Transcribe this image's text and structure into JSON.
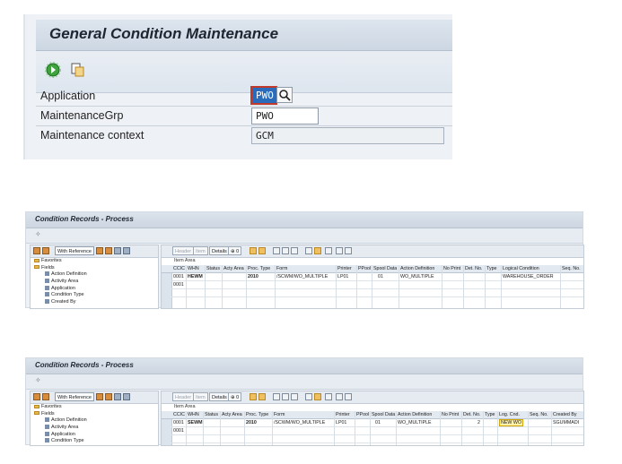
{
  "gcm": {
    "title": "General Condition Maintenance",
    "toolbar": {
      "execute_icon": "execute-icon",
      "copy_icon": "copy-icon"
    },
    "fields": [
      {
        "label": "Application",
        "value": "PWO"
      },
      {
        "label": "MaintenanceGrp",
        "value": "PWO"
      },
      {
        "label": "Maintenance context",
        "value": "GCM"
      }
    ]
  },
  "panels": [
    {
      "title": "Condition Records - Process",
      "toolbar_glyph": "✧",
      "tree_toolbar": {
        "with_reference": "With Reference"
      },
      "tree": [
        "Favorites",
        "Fields",
        "Action Definition",
        "Activity Area",
        "Application",
        "Condition Type",
        "Created By"
      ],
      "grid_toolbar": {
        "header": "Header",
        "item": "Item",
        "details": "Details",
        "zero": "⊕ 0"
      },
      "item_area": "Item Area",
      "columns": [
        "CCIC",
        "WHN",
        "Status",
        "Acty Area",
        "Proc. Type",
        "Form",
        "Printer",
        "PPool",
        "Spool Data",
        "Action Definition",
        "No Print",
        "Det. No.",
        "Type",
        "Logical Condition",
        "Seq. No."
      ],
      "rows": [
        [
          "0001",
          "HEWM",
          "",
          "",
          "2010",
          "/SCWM/WO_MULTIPLE",
          "LP01",
          "",
          "01",
          "WO_MULTIPLE",
          "",
          "",
          "",
          "WAREHOUSE_ORDER",
          ""
        ],
        [
          "0001",
          "",
          "",
          "",
          "",
          "",
          "",
          "",
          "",
          "",
          "",
          "",
          "",
          "",
          ""
        ]
      ]
    },
    {
      "title": "Condition Records - Process",
      "toolbar_glyph": "✧",
      "tree_toolbar": {
        "with_reference": "With Reference"
      },
      "tree": [
        "Favorites",
        "Fields",
        "Action Definition",
        "Activity Area",
        "Application",
        "Condition Type"
      ],
      "grid_toolbar": {
        "header": "Header",
        "item": "Item",
        "details": "Details",
        "zero": "⊕ 0"
      },
      "item_area": "Item Area",
      "columns": [
        "CCIC",
        "WHN",
        "Status",
        "Acty Area",
        "Proc. Type",
        "Form",
        "Printer",
        "PPool",
        "Spool Data",
        "Action Definition",
        "No Print",
        "Det. No.",
        "Type",
        "Log. Cnd.",
        "Seq. No.",
        "Created By"
      ],
      "rows": [
        [
          "0001",
          "SEWM",
          "",
          "",
          "2010",
          "/SCWM/WO_MULTIPLE",
          "LP01",
          "",
          "01",
          "WO_MULTIPLE",
          "",
          "2",
          "",
          "NEW WO",
          "",
          "SGUMMADI"
        ],
        [
          "0001",
          "",
          "",
          "",
          "",
          "",
          "",
          "",
          "",
          "",
          "",
          "",
          "",
          "",
          "",
          ""
        ]
      ]
    }
  ],
  "colors": {
    "accent": "#2a6bbc",
    "highlight": "#fff2a8",
    "focus_border": "#c0392b"
  }
}
